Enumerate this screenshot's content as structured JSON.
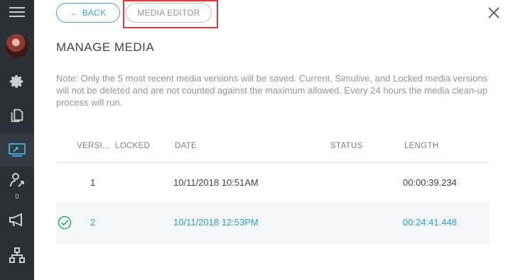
{
  "sidebar": {
    "items": [
      {
        "icon": "menu-icon"
      },
      {
        "icon": "avatar"
      },
      {
        "icon": "gear-icon"
      },
      {
        "icon": "documents-icon"
      },
      {
        "icon": "media-editor-icon",
        "active": true
      },
      {
        "icon": "presenter-icon",
        "badge": "0"
      },
      {
        "icon": "megaphone-icon"
      },
      {
        "icon": "network-icon"
      }
    ]
  },
  "toolbar": {
    "back_label": "BACK",
    "back_arrow": "←",
    "editor_label": "MEDIA EDITOR"
  },
  "page": {
    "title": "MANAGE MEDIA",
    "note": "Note: Only the 5 most recent media versions will be saved. Current, Simulive, and Locked media versions will not be deleted and are not counted against the maximum allowed. Every 24 hours the media clean-up process will run."
  },
  "table": {
    "columns": [
      "VERSI...",
      "LOCKED",
      "DATE",
      "STATUS",
      "LENGTH"
    ],
    "rows": [
      {
        "version": "1",
        "locked": "",
        "date": "10/11/2018 10:51AM",
        "status": "",
        "length": "00:00:39.234",
        "current": false
      },
      {
        "version": "2",
        "locked": "",
        "date": "10/11/2018 12:53PM",
        "status": "",
        "length": "00:24:41.448",
        "current": true
      }
    ]
  },
  "colors": {
    "accent": "#3fa6d6",
    "current_row_text": "#2b9fd2",
    "highlight": "#e23b3b",
    "sidebar_bg": "#2b3036"
  }
}
